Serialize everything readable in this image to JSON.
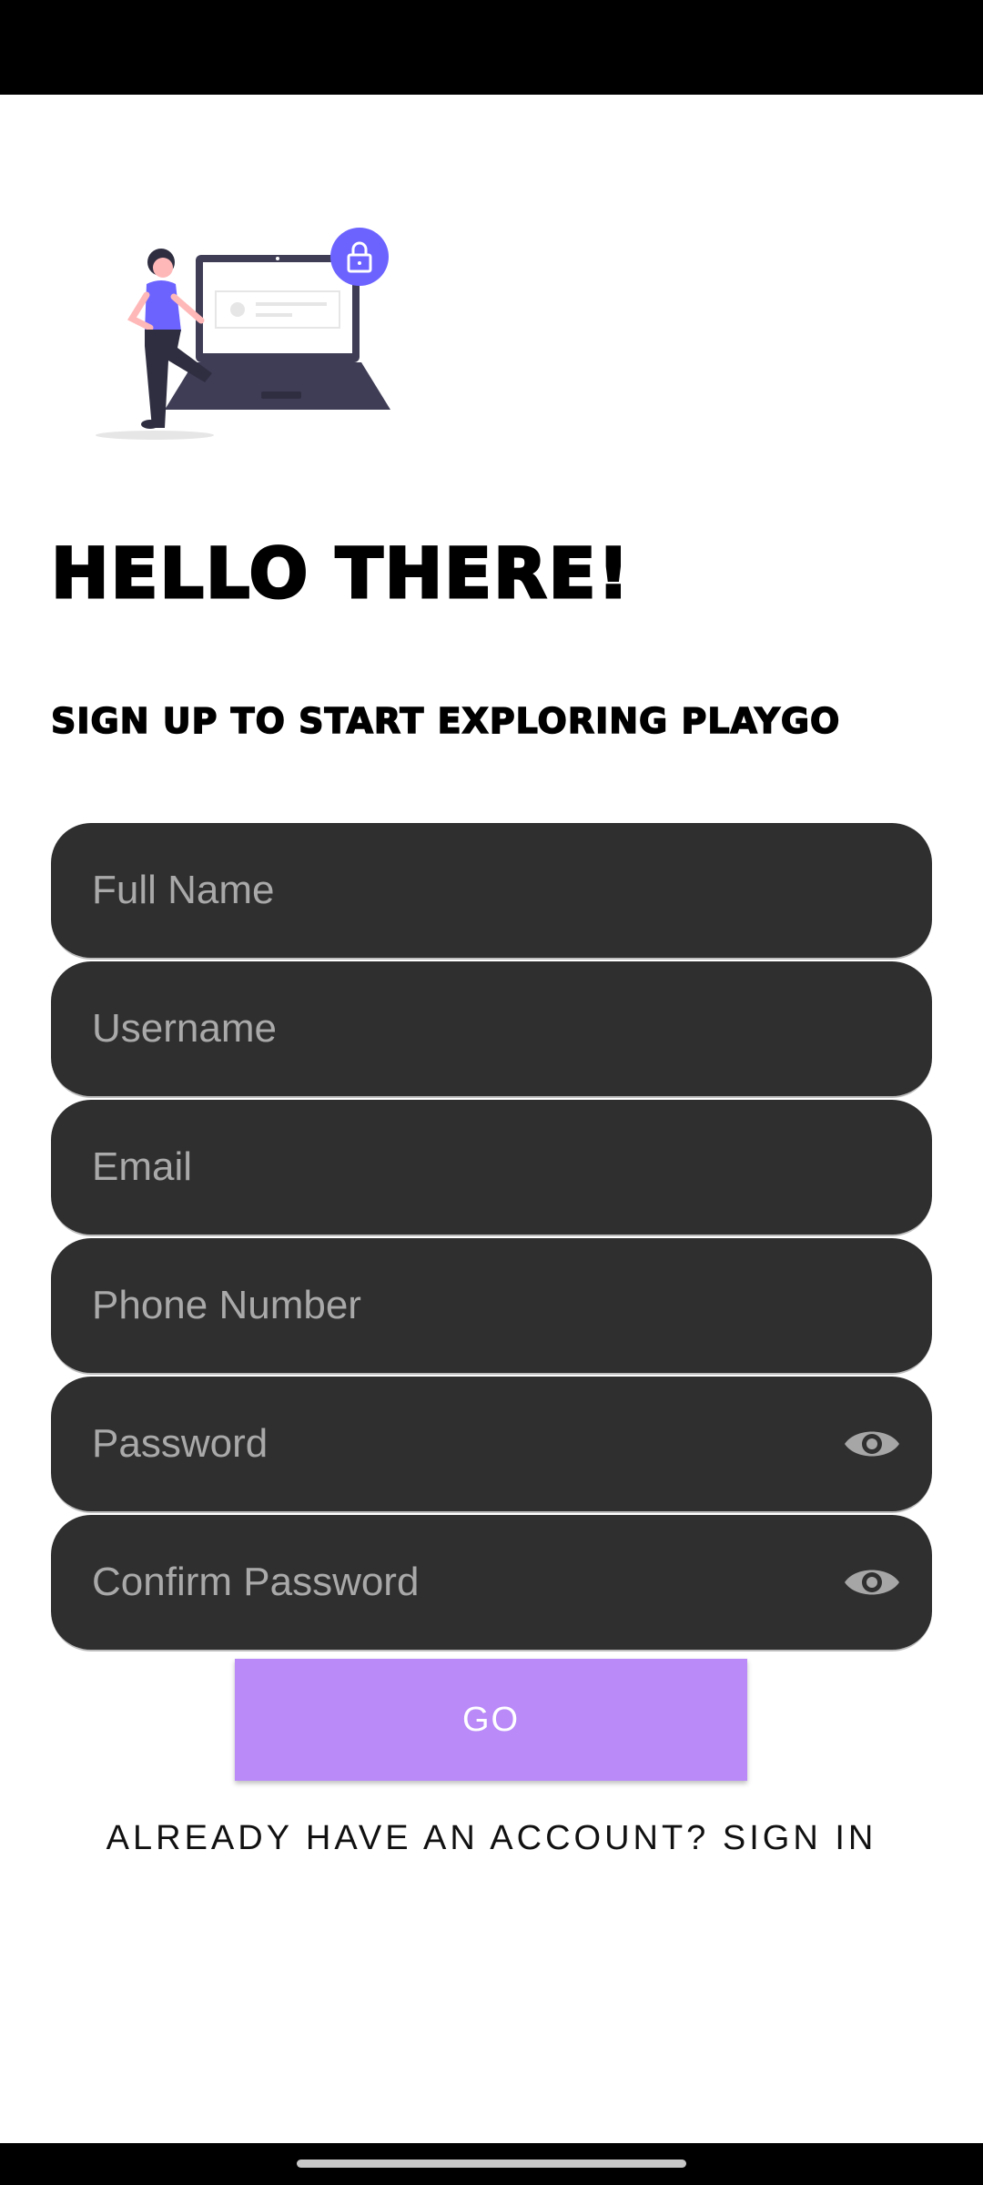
{
  "header": {
    "title": "HELLO THERE!",
    "subtitle": "SIGN UP TO START EXPLORING PLAYGO"
  },
  "form": {
    "full_name": {
      "placeholder": "Full Name"
    },
    "username": {
      "placeholder": "Username"
    },
    "email": {
      "placeholder": "Email"
    },
    "phone": {
      "placeholder": "Phone Number"
    },
    "password": {
      "placeholder": "Password",
      "icon": "eye-icon"
    },
    "confirm_password": {
      "placeholder": "Confirm Password",
      "icon": "eye-icon"
    }
  },
  "actions": {
    "go_label": "GO",
    "signin_label": "ALREADY HAVE AN ACCOUNT? SIGN IN"
  },
  "colors": {
    "field_background": "#2f2f2f",
    "button_background": "#b98af8",
    "illustration_accent": "#6c63ff"
  }
}
